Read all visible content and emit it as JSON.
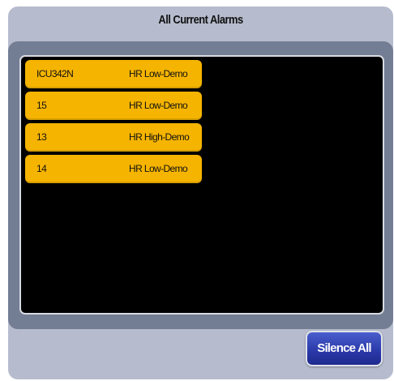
{
  "dialog": {
    "title": "All Current Alarms"
  },
  "alarms": [
    {
      "bed": "ICU342N",
      "message": "HR Low-Demo"
    },
    {
      "bed": "15",
      "message": "HR Low-Demo"
    },
    {
      "bed": "13",
      "message": "HR High-Demo"
    },
    {
      "bed": "14",
      "message": "HR Low-Demo"
    }
  ],
  "actions": {
    "silence_all_label": "Silence All"
  },
  "colors": {
    "alarm_background": "#f5b400",
    "dialog_background": "#b6bccd",
    "panel_background": "#737d93",
    "list_background": "#000000",
    "silence_button": "#2a37a8"
  }
}
